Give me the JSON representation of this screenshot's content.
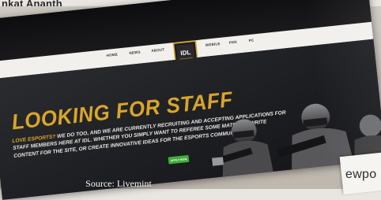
{
  "author": "nkat Ananth",
  "site": {
    "nav": [
      "HOME",
      "NEWS",
      "ABOUT",
      "MOBILE",
      "PSN",
      "PC"
    ],
    "logo_text": "IDL",
    "headline": "LOOKING FOR STAFF",
    "body_lead": "LOVE ESPORTS?",
    "body_rest": "WE DO TOO, AND WE ARE CURRENTLY RECRUITING AND ACCEPTING APPLICATIONS FOR STAFF MEMBERS HERE AT IDL. WHETHER YOU SIMPLY WANT TO REFEREE SOME MATCHES, WRITE CONTENT FOR THE SITE, OR CREATE INNOVATIVE IDEAS FOR THE ESPORTS COMMUNITY",
    "cta": "APPLY NOW",
    "accent": "#d9a52a",
    "cta_color": "#3fae3a"
  },
  "paper_corner_text": "ewpo",
  "caption": "Source: Livemint"
}
